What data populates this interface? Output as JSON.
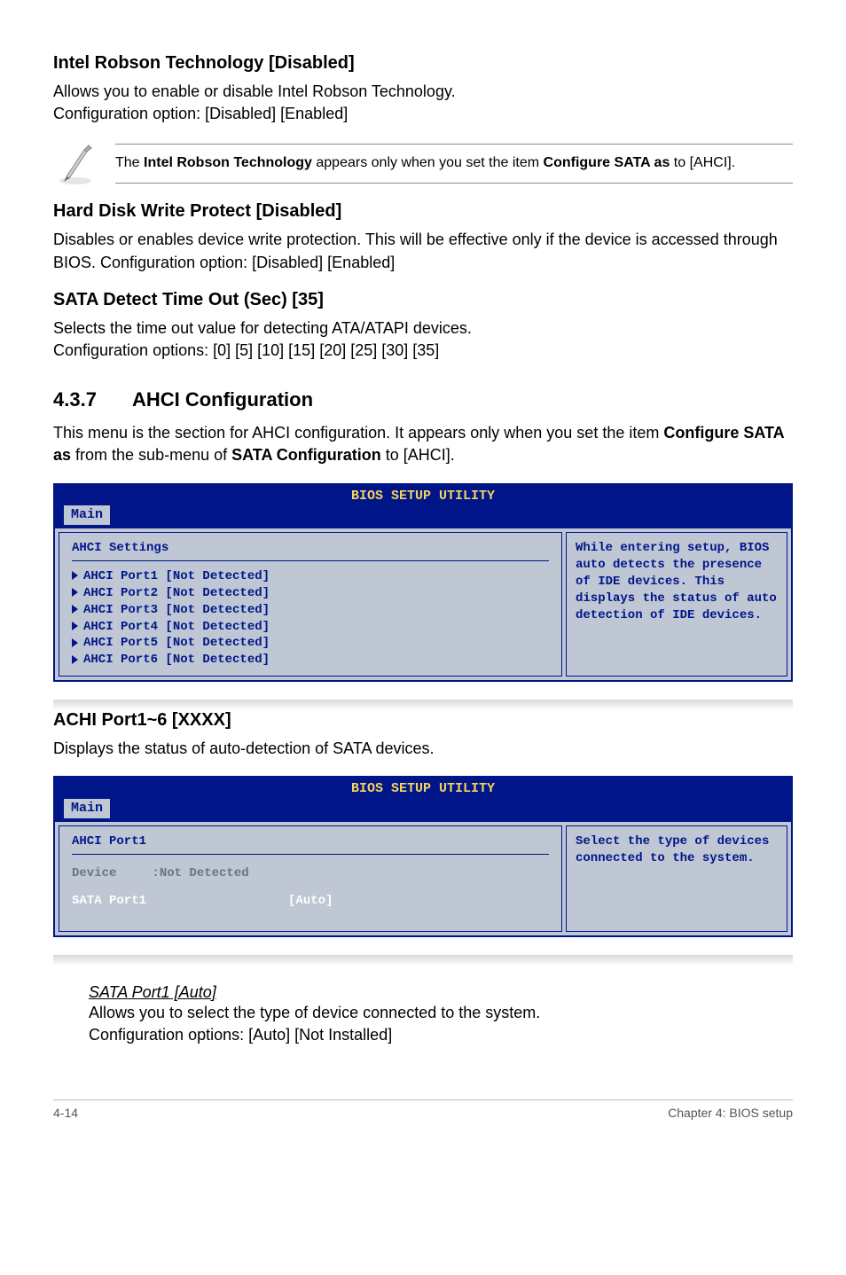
{
  "section1": {
    "title": "Intel Robson Technology [Disabled]",
    "desc": "Allows you to enable or disable Intel Robson Technology.\nConfiguration option: [Disabled] [Enabled]"
  },
  "note": {
    "prefix": "The ",
    "bold1": "Intel Robson Technology",
    "mid": " appears only when you set the item ",
    "bold2": "Configure SATA as",
    "suffix": " to [AHCI]."
  },
  "section2": {
    "title": "Hard Disk Write Protect [Disabled]",
    "desc": "Disables or enables device write protection. This will be effective only if the device is accessed through BIOS. Configuration option: [Disabled] [Enabled]"
  },
  "section3": {
    "title": "SATA Detect Time Out (Sec) [35]",
    "desc": "Selects the time out value for detecting ATA/ATAPI devices.\nConfiguration options: [0] [5] [10] [15] [20] [25] [30] [35]"
  },
  "section437": {
    "num": "4.3.7",
    "title": "AHCI Configuration",
    "desc_pre": "This menu is the section for AHCI configuration. It appears only when you set the item ",
    "desc_b1": "Configure SATA as",
    "desc_mid": " from the sub-menu of ",
    "desc_b2": "SATA Configuration",
    "desc_post": " to [AHCI]."
  },
  "bios1": {
    "title": "BIOS SETUP UTILITY",
    "tab": "Main",
    "left_title": "AHCI Settings",
    "items": [
      "AHCI Port1 [Not Detected]",
      "AHCI Port2 [Not Detected]",
      "AHCI Port3 [Not Detected]",
      "AHCI Port4 [Not Detected]",
      "AHCI Port5 [Not Detected]",
      "AHCI Port6 [Not Detected]"
    ],
    "right": "While entering setup, BIOS auto detects the presence of IDE devices. This displays the status of auto detection of IDE devices."
  },
  "achi": {
    "title": "ACHI Port1~6 [XXXX]",
    "desc": "Displays the status of auto-detection of SATA devices."
  },
  "bios2": {
    "title": "BIOS SETUP UTILITY",
    "tab": "Main",
    "left_title": "AHCI Port1",
    "device_label": "Device",
    "device_value": ":Not Detected",
    "sata_label": "SATA Port1",
    "sata_value": "[Auto]",
    "right": "Select the type of devices connected to the system."
  },
  "sata_port": {
    "heading": "SATA Port1 [Auto]",
    "line1": "Allows you to select the type of device connected to the system.",
    "line2": "Configuration options: [Auto] [Not Installed]"
  },
  "footer": {
    "left": "4-14",
    "right": "Chapter 4: BIOS setup"
  }
}
